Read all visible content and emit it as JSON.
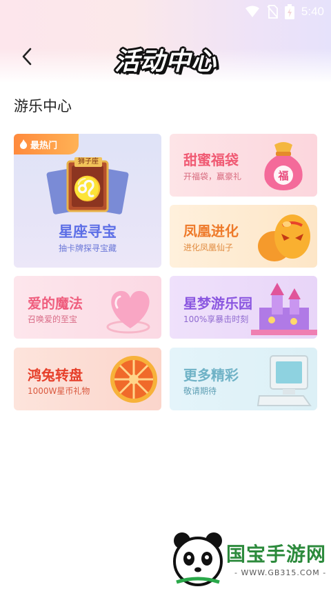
{
  "status": {
    "time": "5:40"
  },
  "header": {
    "title": "活动中心"
  },
  "section": {
    "title": "游乐中心"
  },
  "cards": {
    "xingzuo": {
      "title": "星座寻宝",
      "subtitle": "抽卡牌探寻宝藏",
      "badge": "最热门",
      "card_label": "狮子座"
    },
    "tianmi": {
      "title": "甜蜜福袋",
      "subtitle": "开福袋，赢豪礼",
      "bag_char": "福"
    },
    "fenghuang": {
      "title": "凤凰进化",
      "subtitle": "进化凤凰仙子"
    },
    "aide": {
      "title": "爱的魔法",
      "subtitle": "召唤爱的至宝"
    },
    "xingmeng": {
      "title": "星梦游乐园",
      "subtitle": "100%享暴击时刻"
    },
    "hongtu": {
      "title": "鸿兔转盘",
      "subtitle": "1000W星币礼物"
    },
    "gengduo": {
      "title": "更多精彩",
      "subtitle": "敬请期待"
    }
  },
  "watermark": {
    "brand": "国宝手游网",
    "url": "- WWW.GB315.COM -"
  },
  "colors": {
    "pink_title": "#f0506e",
    "blue_title": "#6a78e8",
    "purple_title": "#8a5ce0",
    "red_title": "#e8402c",
    "cyan_title": "#6fb2c6",
    "badge": "#ff8a3d"
  }
}
